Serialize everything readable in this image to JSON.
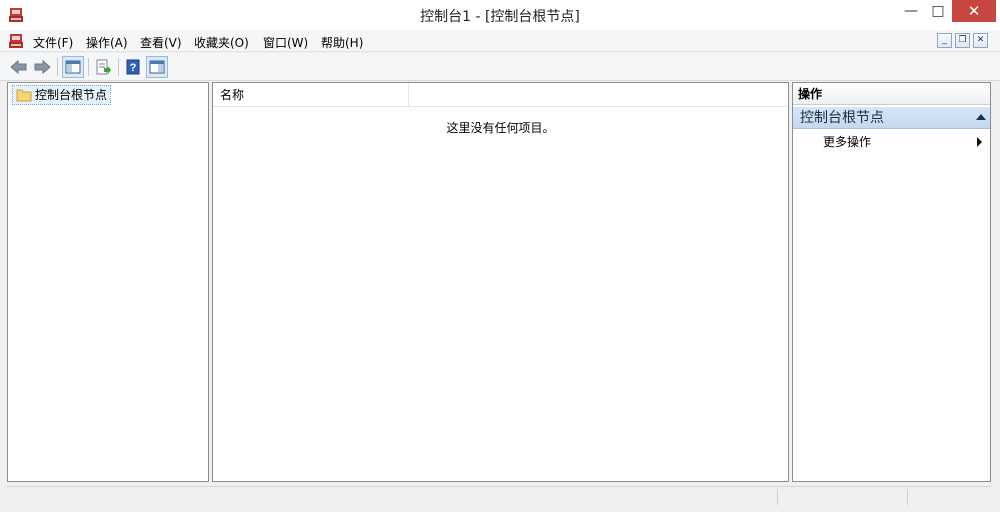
{
  "window": {
    "title": "控制台1 - [控制台根节点]",
    "minimize_glyph": "—",
    "maximize_glyph": "□",
    "close_glyph": "✕"
  },
  "menubar": {
    "items": [
      {
        "label": "文件(F)"
      },
      {
        "label": "操作(A)"
      },
      {
        "label": "查看(V)"
      },
      {
        "label": "收藏夹(O)"
      },
      {
        "label": "窗口(W)"
      },
      {
        "label": "帮助(H)"
      }
    ],
    "mdi": {
      "minimize": "_",
      "restore": "❐",
      "close": "✕"
    }
  },
  "toolbar": {
    "icons": [
      "back-arrow-icon",
      "forward-arrow-icon",
      "show-hide-console-tree-icon",
      "export-list-icon",
      "help-icon",
      "show-hide-action-pane-icon"
    ]
  },
  "tree": {
    "root_label": "控制台根节点"
  },
  "list": {
    "column_name": "名称",
    "empty_message": "这里没有任何项目。"
  },
  "actions": {
    "title": "操作",
    "section_label": "控制台根节点",
    "more_actions_label": "更多操作"
  },
  "colors": {
    "close_button": "#c7463f",
    "selection_bg": "#e5f1fb",
    "section_bg": "#c9dcf1"
  }
}
